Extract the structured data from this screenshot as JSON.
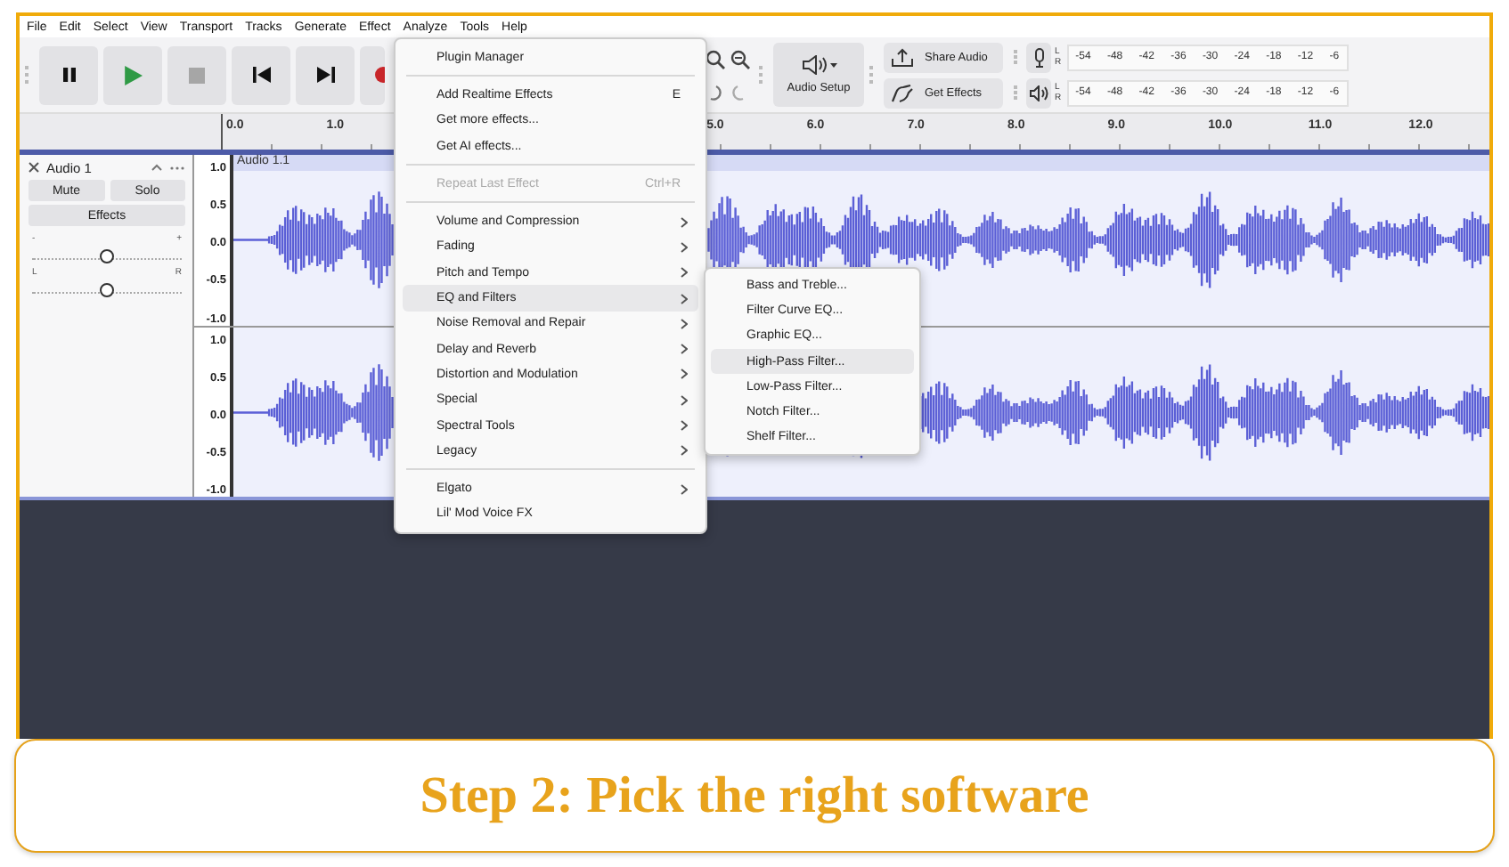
{
  "menu_bar": [
    "File",
    "Edit",
    "Select",
    "View",
    "Transport",
    "Tracks",
    "Generate",
    "Effect",
    "Analyze",
    "Tools",
    "Help"
  ],
  "toolbar": {
    "audio_setup": "Audio Setup",
    "share_audio": "Share Audio",
    "get_effects": "Get Effects"
  },
  "meters": [
    {
      "kind": "record",
      "left": "L",
      "right": "R",
      "ticks": [
        "-54",
        "-48",
        "-42",
        "-36",
        "-30",
        "-24",
        "-18",
        "-12",
        "-6"
      ]
    },
    {
      "kind": "playback",
      "left": "L",
      "right": "R",
      "ticks": [
        "-54",
        "-48",
        "-42",
        "-36",
        "-30",
        "-24",
        "-18",
        "-12",
        "-6"
      ]
    }
  ],
  "timeline": {
    "ticks_before_menu": [
      "0.0",
      "1.0"
    ],
    "ticks_after_menu": [
      "5.0",
      "6.0",
      "7.0",
      "8.0",
      "9.0",
      "10.0",
      "11.0",
      "12.0"
    ]
  },
  "track": {
    "name": "Audio 1",
    "clip": "Audio 1.1",
    "mute": "Mute",
    "solo": "Solo",
    "effects": "Effects",
    "gain": {
      "minus": "-",
      "plus": "+",
      "level": 0.5
    },
    "pan": {
      "left": "L",
      "right": "R",
      "level": 0.5
    },
    "channels": [
      {
        "scale": [
          "1.0",
          "0.5",
          "0.0",
          "-0.5",
          "-1.0"
        ]
      },
      {
        "scale": [
          "1.0",
          "0.5",
          "0.0",
          "-0.5",
          "-1.0"
        ]
      }
    ]
  },
  "effect_menu": {
    "items": [
      {
        "kind": "item",
        "label": "Plugin Manager",
        "submenu": false,
        "disabled": false,
        "selected": false
      },
      {
        "kind": "separator"
      },
      {
        "kind": "item",
        "label": "Add Realtime Effects",
        "shortcut": "E",
        "submenu": false,
        "disabled": false,
        "selected": false
      },
      {
        "kind": "item",
        "label": "Get more effects...",
        "submenu": false,
        "disabled": false,
        "selected": false
      },
      {
        "kind": "item",
        "label": "Get AI effects...",
        "submenu": false,
        "disabled": false,
        "selected": false
      },
      {
        "kind": "separator"
      },
      {
        "kind": "item",
        "label": "Repeat Last Effect",
        "shortcut": "Ctrl+R",
        "submenu": false,
        "disabled": true,
        "selected": false
      },
      {
        "kind": "separator"
      },
      {
        "kind": "item",
        "label": "Volume and Compression",
        "submenu": true,
        "disabled": false,
        "selected": false
      },
      {
        "kind": "item",
        "label": "Fading",
        "submenu": true,
        "disabled": false,
        "selected": false
      },
      {
        "kind": "item",
        "label": "Pitch and Tempo",
        "submenu": true,
        "disabled": false,
        "selected": false
      },
      {
        "kind": "item",
        "label": "EQ and Filters",
        "submenu": true,
        "disabled": false,
        "selected": true
      },
      {
        "kind": "item",
        "label": "Noise Removal and Repair",
        "submenu": true,
        "disabled": false,
        "selected": false
      },
      {
        "kind": "item",
        "label": "Delay and Reverb",
        "submenu": true,
        "disabled": false,
        "selected": false
      },
      {
        "kind": "item",
        "label": "Distortion and Modulation",
        "submenu": true,
        "disabled": false,
        "selected": false
      },
      {
        "kind": "item",
        "label": "Special",
        "submenu": true,
        "disabled": false,
        "selected": false
      },
      {
        "kind": "item",
        "label": "Spectral Tools",
        "submenu": true,
        "disabled": false,
        "selected": false
      },
      {
        "kind": "item",
        "label": "Legacy",
        "submenu": true,
        "disabled": false,
        "selected": false
      },
      {
        "kind": "separator"
      },
      {
        "kind": "item",
        "label": "Elgato",
        "submenu": true,
        "disabled": false,
        "selected": false
      },
      {
        "kind": "item",
        "label": "Lil' Mod Voice FX",
        "submenu": false,
        "disabled": false,
        "selected": false
      }
    ]
  },
  "submenu": {
    "items": [
      {
        "label": "Bass and Treble...",
        "selected": false
      },
      {
        "label": "Filter Curve EQ...",
        "selected": false
      },
      {
        "label": "Graphic EQ...",
        "selected": false
      },
      {
        "label": "High-Pass Filter...",
        "selected": true
      },
      {
        "label": "Low-Pass Filter...",
        "selected": false
      },
      {
        "label": "Notch Filter...",
        "selected": false
      },
      {
        "label": "Shelf Filter...",
        "selected": false
      }
    ]
  },
  "caption": "Step 2: Pick the right software"
}
